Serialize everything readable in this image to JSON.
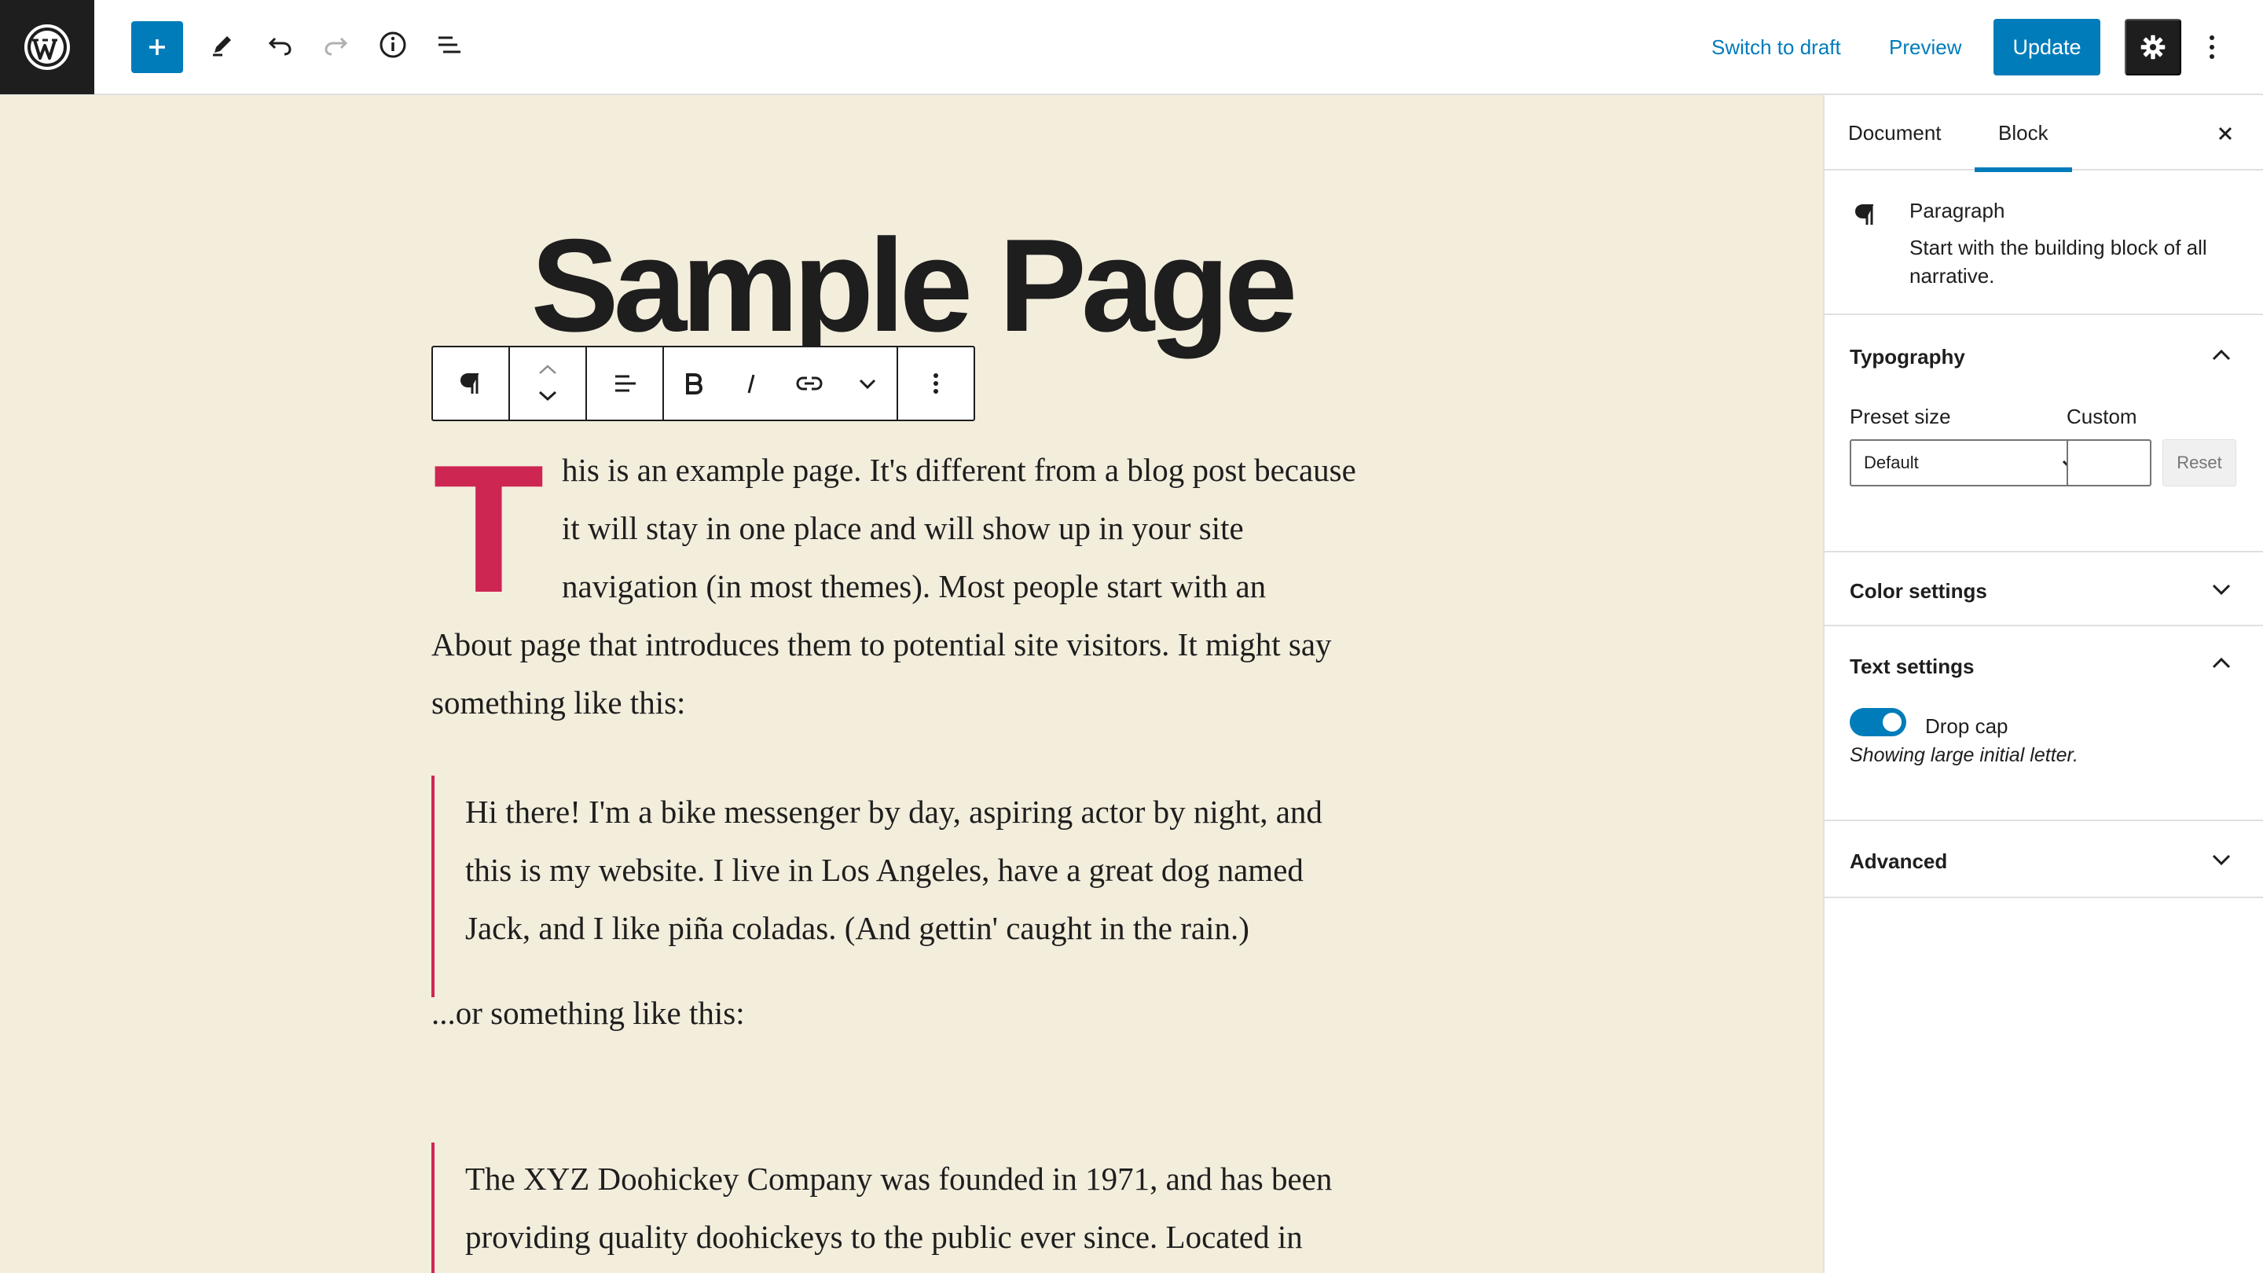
{
  "topbar": {
    "wp_logo_label": "W",
    "switch_to_draft": "Switch to draft",
    "preview": "Preview",
    "update": "Update"
  },
  "document": {
    "title": "Sample Page",
    "dropcap_letter": "T",
    "para1_lines": [
      "his is an example page. It's different from a blog post because",
      "it will stay in one place and will show up in your site",
      "navigation (in most themes). Most people start with an"
    ],
    "para1_rest": [
      "About page that introduces them to potential site visitors. It might say",
      "something like this:"
    ],
    "quote1_lines": [
      "Hi there! I'm a bike messenger by day, aspiring actor by night, and",
      "this is my website. I live in Los Angeles, have a great dog named",
      "Jack, and I like piña coladas. (And gettin' caught in the rain.)"
    ],
    "para2": "...or something like this:",
    "quote2_lines": [
      "The XYZ Doohickey Company was founded in 1971, and has been",
      "providing quality doohickeys to the public ever since. Located in"
    ]
  },
  "sidebar": {
    "tabs": [
      "Document",
      "Block"
    ],
    "active_tab": "Block",
    "block": {
      "name": "Paragraph",
      "description_lines": [
        "Start with the building block of all",
        "narrative."
      ]
    },
    "typography": {
      "title": "Typography",
      "preset_label": "Preset size",
      "custom_label": "Custom",
      "preset_value": "Default",
      "reset": "Reset"
    },
    "color_settings": "Color settings",
    "text_settings": {
      "title": "Text settings",
      "toggle_label": "Drop cap",
      "toggle_on": true,
      "help": "Showing large initial letter."
    },
    "advanced": "Advanced"
  },
  "colors": {
    "accent": "#007cba",
    "dropcap": "#cd2653",
    "canvas": "#f3eddc",
    "dark": "#1e1e1e"
  }
}
